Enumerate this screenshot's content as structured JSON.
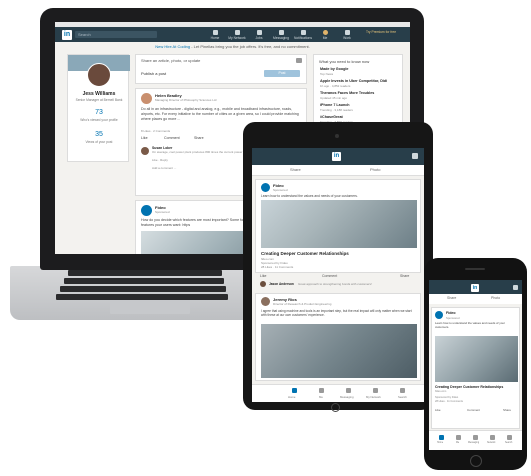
{
  "laptop": {
    "search_placeholder": "Search",
    "nav": [
      "Home",
      "My Network",
      "Jobs",
      "Messaging",
      "Notifications",
      "Me",
      "Work",
      "Try Premium for free"
    ],
    "promo_link": "New Hire At Coding",
    "promo_text": " - Let Pinellas bring you the job offers. It's free, and no commitment.",
    "profile": {
      "name": "Jess Williams",
      "role": "Senior Manager at Bernell Bank",
      "views_num": "73",
      "views_label": "Who's viewed your profile",
      "post_num": "35",
      "post_label": "Views of your post"
    },
    "share_prompt": "Share an article, photo, or update",
    "publish": "Publish a post",
    "post_button": "Post",
    "feed": {
      "author": "Helen Bradley",
      "author_sub": "Managing Director of Philosophy Sciences Ltd",
      "body": "Do all in an infrastructure - digital and analog, e.g., mobile and broadband infrastructure, roads, airports, etc. For every initiative to the number of cities on a given area, so I could provide matching where places go more ...",
      "likes": "8 Likes · 2 Comments",
      "actions": [
        "Like",
        "Comment",
        "Share"
      ],
      "comment_author": "Susan Loker",
      "comment_text": "On average, cool power plant produces 800 times the current power plants",
      "comment_meta": "Like · Reply",
      "add_comment": "Add a comment ..."
    },
    "feed2": {
      "author": "Fideo",
      "author_sub": "Sponsored",
      "body": "How do you decide which features are most important? Some for a complete guide to building features your users want: https"
    },
    "news": {
      "header": "What you need to know now",
      "items": [
        {
          "title": "Made by Google",
          "sub": "Top News"
        },
        {
          "title": "Apple Invests in Uber Competitor, Didi",
          "sub": "1h ago · 4,852 readers"
        },
        {
          "title": "Theranos Faces More Troubles",
          "sub": "Updated 45 min ago"
        },
        {
          "title": "iPhone 7 Launch",
          "sub": "Trending · 3,188 readers"
        },
        {
          "title": "#ChaseGreat",
          "sub": "Trending · 7,890 readers"
        }
      ]
    }
  },
  "tablet": {
    "share": "Share",
    "photo": "Photo",
    "company": "Fideo",
    "company_sub": "Sponsored",
    "post_text": "Learn how to understand the values and needs of your customers.",
    "article_title": "Creating Deeper Customer Relationships",
    "article_url": "fideo.com",
    "sponsored": "Sponsored by Fideo",
    "stats": "28 Likes · 11 Comments",
    "actions": [
      "Like",
      "Comment",
      "Share"
    ],
    "comment": "Jason Anderson",
    "comment_text": "Great approach to strengthening bonds with customers!",
    "author2": "Jeremy Rios",
    "author2_sub": "Director of Research & Product Engineering",
    "body2": "I agree that using machine and tools is an important step, but the real impact will only matter when we start with these at our own customers' experience.",
    "bottom": [
      "Home",
      "Me",
      "Messaging",
      "My Network",
      "Search"
    ]
  },
  "phone": {
    "share": "Share",
    "photo": "Photo",
    "company": "Fideo",
    "company_sub": "Sponsored",
    "post_text": "Learn how to understand the values and needs of your customers.",
    "article_title": "Creating Deeper Customer Relationships",
    "article_url": "fideo.com",
    "sponsored": "Sponsored by Fideo",
    "stats": "28 Likes · 11 Comments",
    "actions": [
      "Like",
      "Comment",
      "Share"
    ],
    "bottom": [
      "Home",
      "Me",
      "Messaging",
      "Network",
      "Search"
    ]
  },
  "colors": {
    "linkedin_blue": "#0073b1",
    "nav_dark": "#283e4a",
    "device_black": "#1c1c1e"
  }
}
